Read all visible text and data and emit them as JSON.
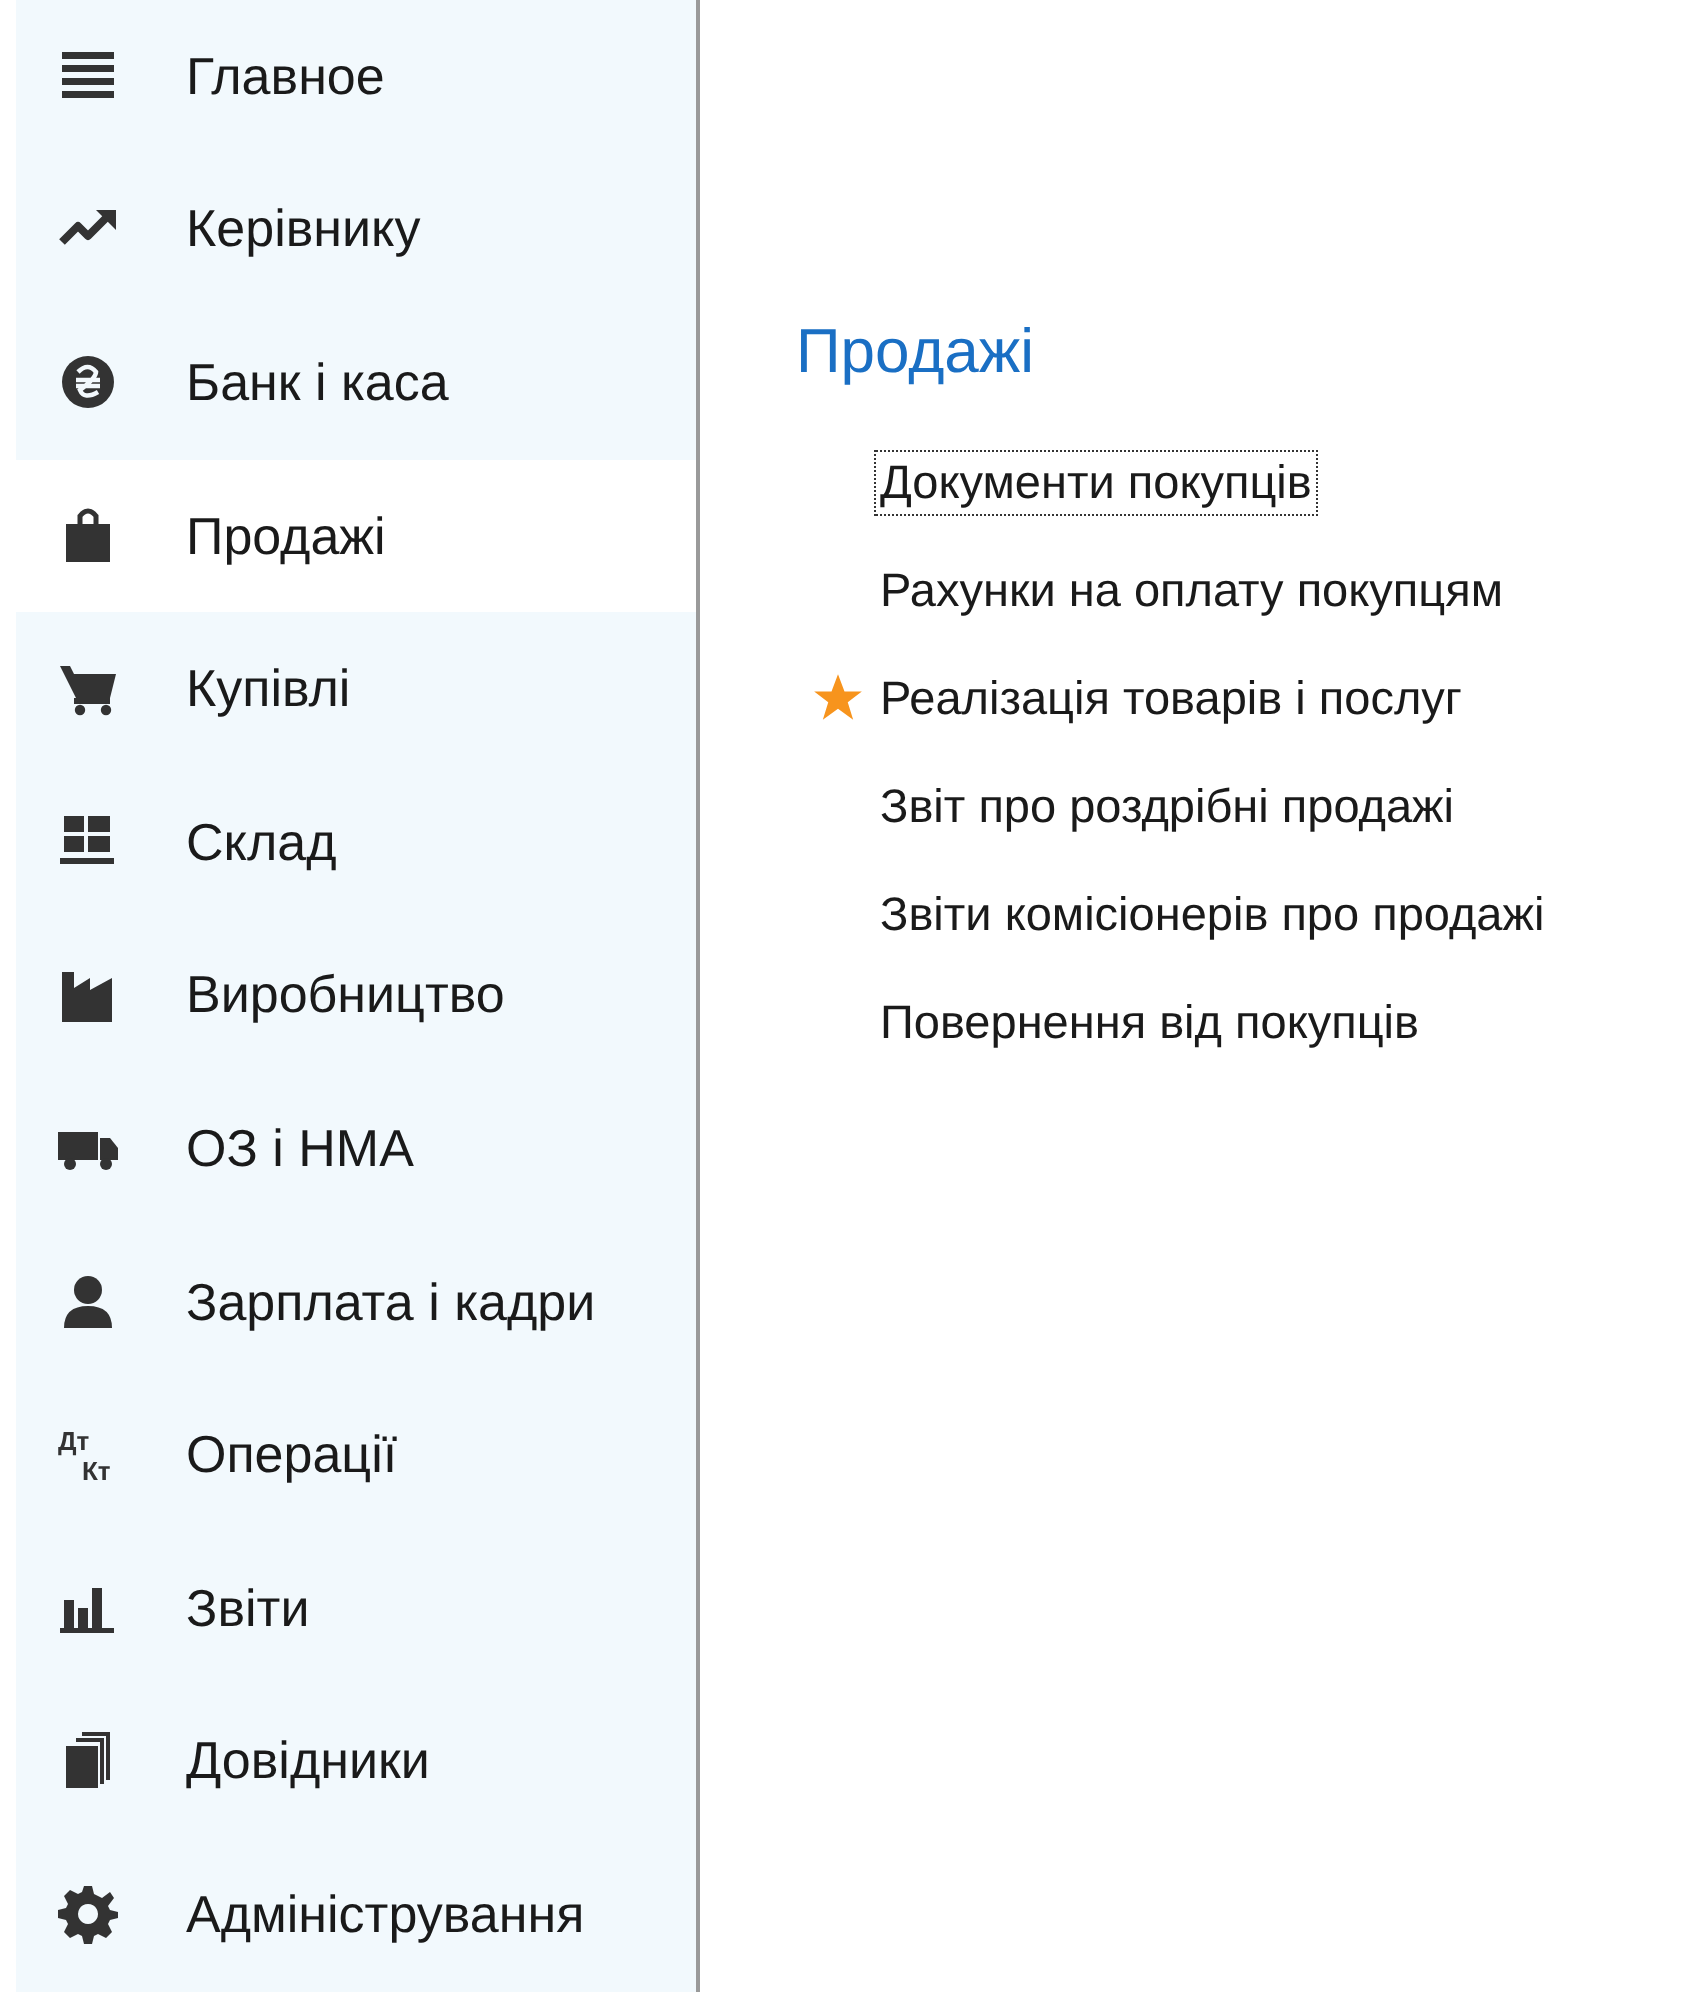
{
  "sidebar": {
    "items": [
      {
        "label": "Главное",
        "selected": false
      },
      {
        "label": "Керівнику",
        "selected": false
      },
      {
        "label": "Банк і каса",
        "selected": false
      },
      {
        "label": "Продажі",
        "selected": true
      },
      {
        "label": "Купівлі",
        "selected": false
      },
      {
        "label": "Склад",
        "selected": false
      },
      {
        "label": "Виробництво",
        "selected": false
      },
      {
        "label": "ОЗ і НМА",
        "selected": false
      },
      {
        "label": "Зарплата і кадри",
        "selected": false
      },
      {
        "label": "Операції",
        "selected": false,
        "icon_text": [
          "Дт",
          "Кт"
        ]
      },
      {
        "label": "Звіти",
        "selected": false
      },
      {
        "label": "Довідники",
        "selected": false
      },
      {
        "label": "Адміністрування",
        "selected": false
      }
    ]
  },
  "section": {
    "title": "Продажі",
    "links": [
      {
        "label": "Документи покупців",
        "favorite": false,
        "focused": true
      },
      {
        "label": "Рахунки на оплату покупцям",
        "favorite": false,
        "focused": false
      },
      {
        "label": "Реалізація товарів і послуг",
        "favorite": true,
        "focused": false
      },
      {
        "label": "Звіт про роздрібні продажі",
        "favorite": false,
        "focused": false
      },
      {
        "label": "Звіти комісіонерів про продажі",
        "favorite": false,
        "focused": false
      },
      {
        "label": "Повернення від покупців",
        "favorite": false,
        "focused": false
      }
    ]
  }
}
